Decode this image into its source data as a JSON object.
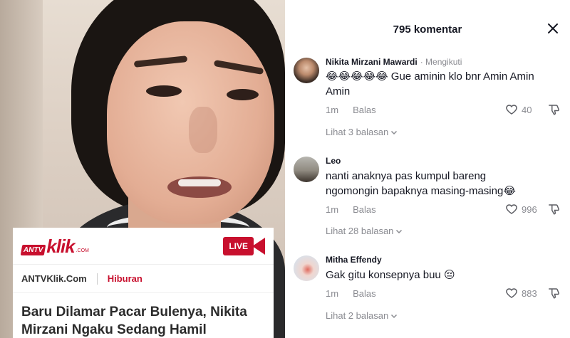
{
  "comments_panel": {
    "title": "795 komentar",
    "comments": [
      {
        "username": "Nikita Mirzani Mawardi",
        "follow_label": "· Mengikuti",
        "text": "😂😂😂😂😂 Gue aminin klo bnr Amin Amin Amin",
        "time": "1m",
        "reply_label": "Balas",
        "likes": "40",
        "replies_label": "Lihat 3 balasan"
      },
      {
        "username": "Leo",
        "text": "nanti anaknya pas kumpul bareng ngomongin bapaknya masing-masing😂",
        "time": "1m",
        "reply_label": "Balas",
        "likes": "996",
        "replies_label": "Lihat 28 balasan"
      },
      {
        "username": "Mitha Effendy",
        "text": "Gak gitu konsepnya buu 😔",
        "time": "1m",
        "reply_label": "Balas",
        "likes": "883",
        "replies_label": "Lihat 2 balasan"
      }
    ]
  },
  "news_card": {
    "logo_antv": "ANTV",
    "logo_klik": "klik",
    "logo_com": ".COM",
    "live_label": "LIVE",
    "site": "ANTVKlik.Com",
    "category": "Hiburan",
    "headline": "Baru Dilamar Pacar Bulenya, Nikita Mirzani Ngaku Sedang Hamil"
  },
  "colors": {
    "brand_red": "#c8102e",
    "text_primary": "#161823",
    "text_secondary": "#8a8b91"
  }
}
